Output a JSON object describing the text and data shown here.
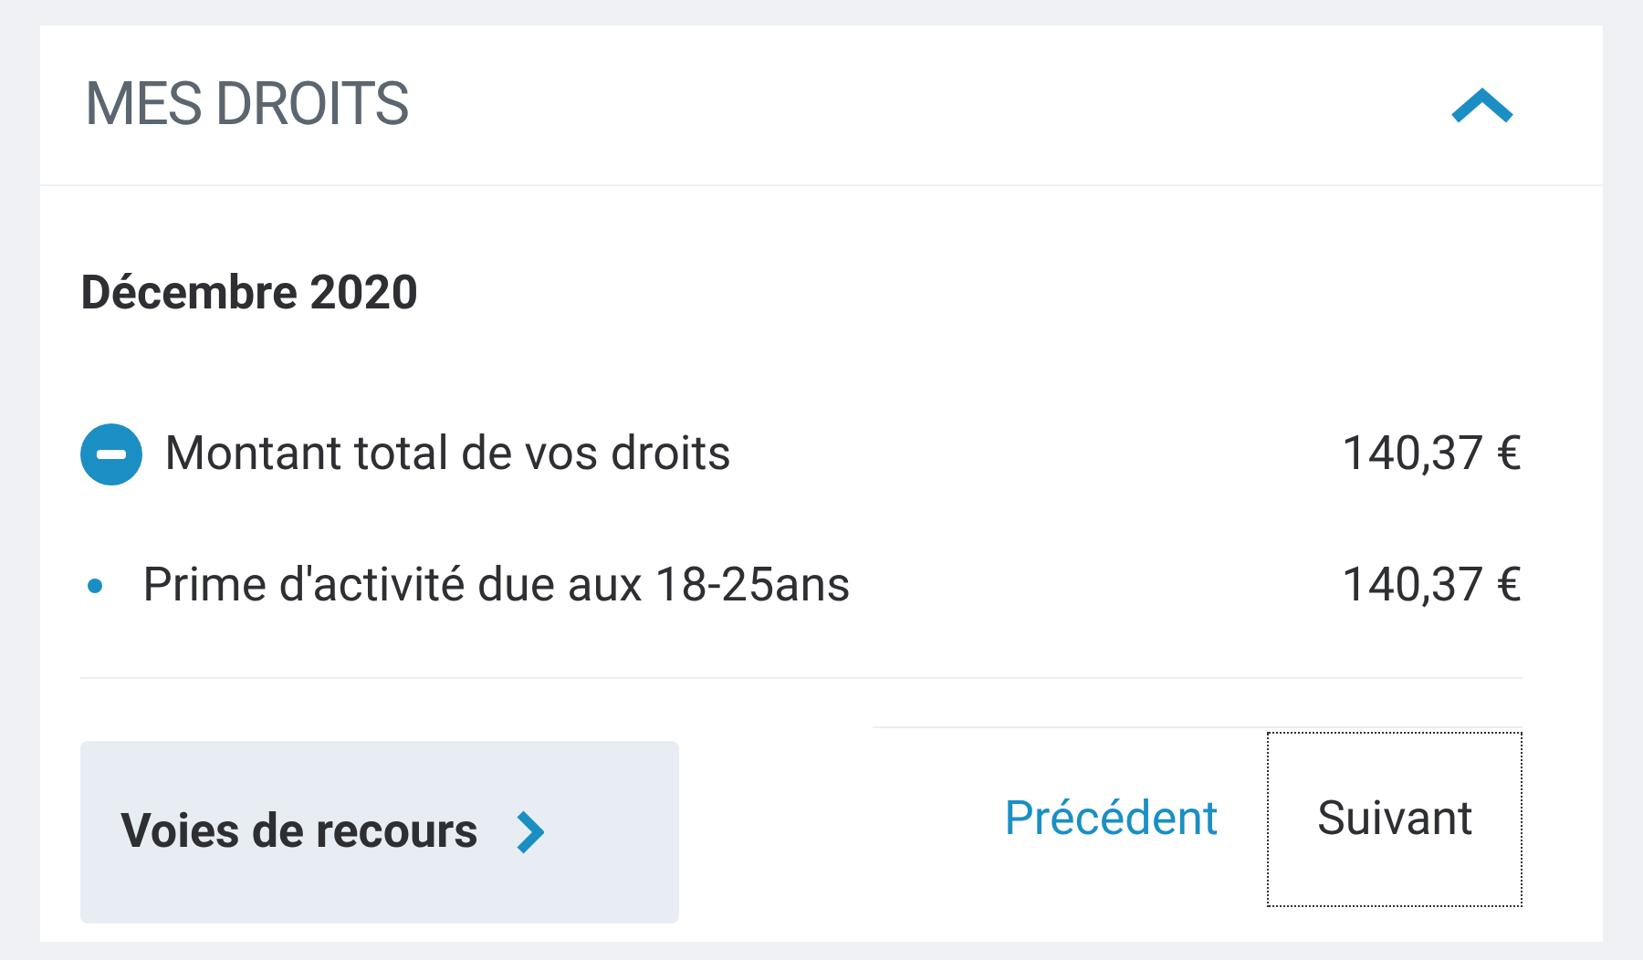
{
  "section": {
    "title": "MES DROITS",
    "expanded": true
  },
  "period": "Décembre 2020",
  "rows": [
    {
      "kind": "total",
      "label": "Montant total de vos droits",
      "amount": "140,37 €"
    },
    {
      "kind": "item",
      "label": "Prime d'activité due aux 18-25ans",
      "amount": "140,37 €"
    }
  ],
  "recourse_button": {
    "label": "Voies de recours"
  },
  "pagination": [
    {
      "label": "Précédent",
      "focused": false
    },
    {
      "label": "Suivant",
      "focused": true
    }
  ]
}
